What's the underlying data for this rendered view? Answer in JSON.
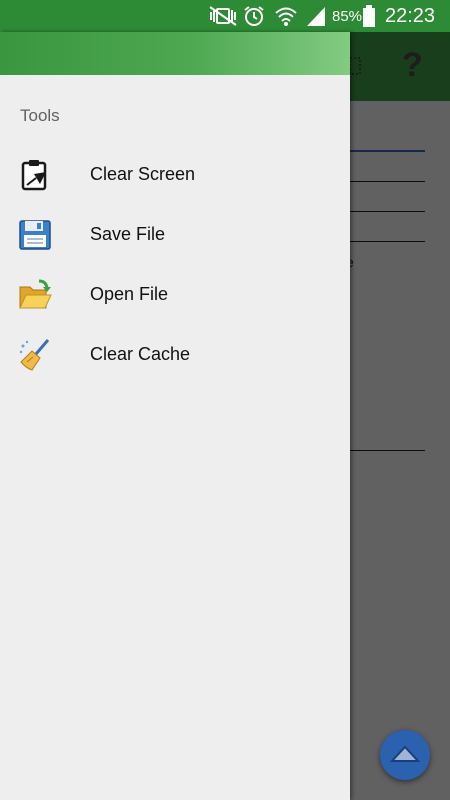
{
  "status_bar": {
    "battery": "85%",
    "time": "22:23",
    "icons": [
      "mute-vibrate-icon",
      "alarm-icon",
      "wifi-icon",
      "signal-icon",
      "battery-icon"
    ]
  },
  "background_app": {
    "partial_text": "e",
    "help_label": "?",
    "fab_icon": "chevron-up-icon"
  },
  "drawer": {
    "section_title": "Tools",
    "items": [
      {
        "label": "Clear Screen",
        "icon": "clipboard-clear-icon"
      },
      {
        "label": "Save File",
        "icon": "floppy-disk-icon"
      },
      {
        "label": "Open File",
        "icon": "open-folder-icon"
      },
      {
        "label": "Clear Cache",
        "icon": "broom-icon"
      }
    ]
  },
  "colors": {
    "status_bar": "#2d8a35",
    "app_bar": "#3f9b45",
    "drawer_bg": "#eeeeee",
    "fab": "#2a62b0"
  }
}
